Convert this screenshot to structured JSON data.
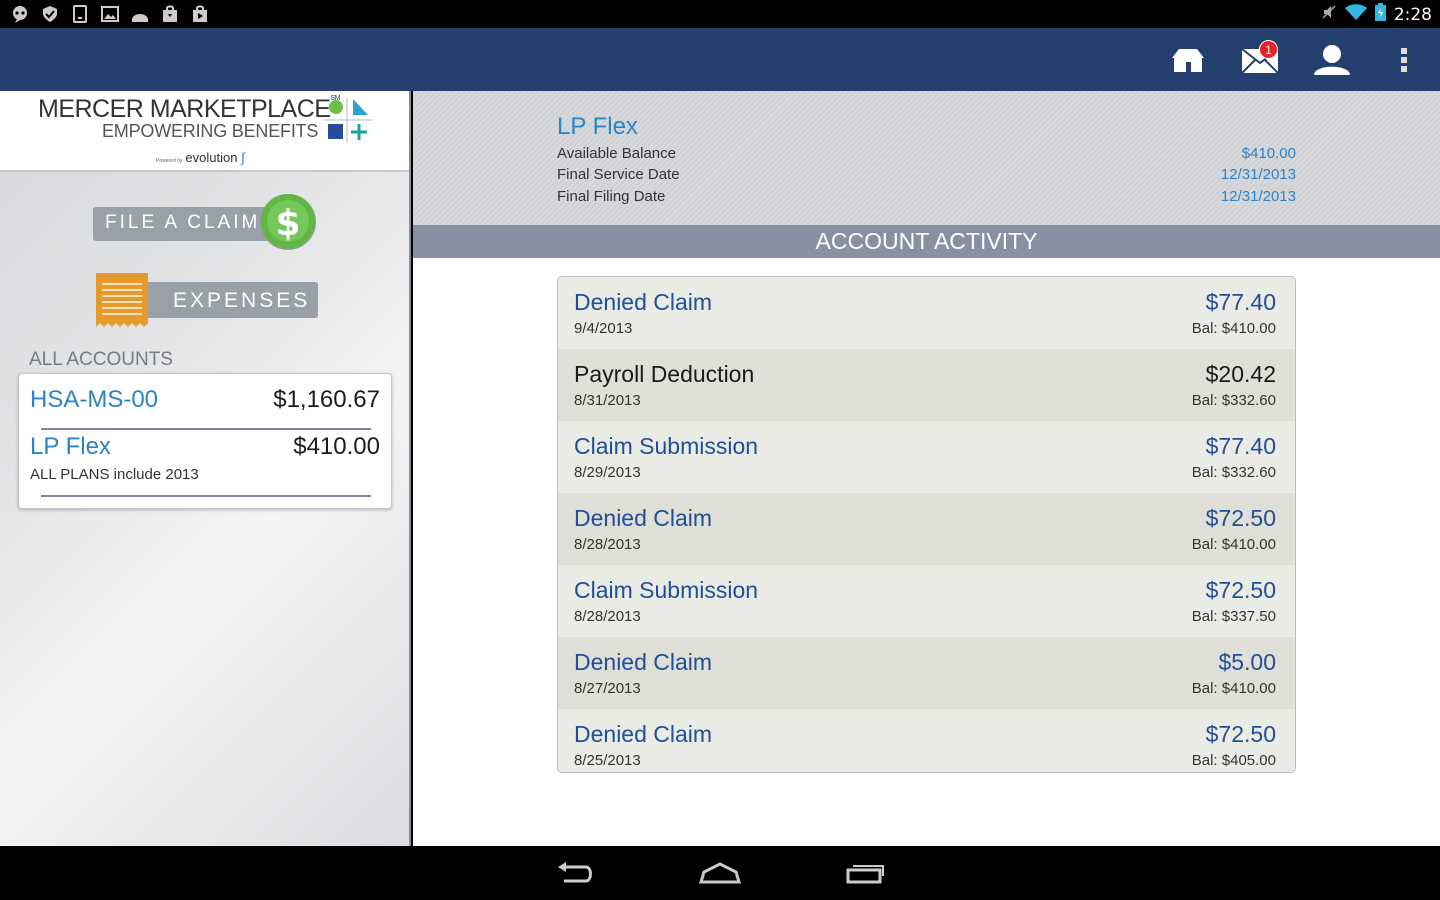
{
  "status_bar": {
    "time": "2:28"
  },
  "action_bar": {
    "mail_badge": "1"
  },
  "logo": {
    "title": "MERCER MARKETPLACE",
    "sm": "SM",
    "subtitle": "EMPOWERING BENEFITS",
    "powered_by": "Powered by",
    "evolution": "evolution"
  },
  "sidebar": {
    "file_claim_label": "FILE A CLAIM",
    "expenses_label": "EXPENSES",
    "all_accounts_label": "ALL ACCOUNTS",
    "accounts": [
      {
        "name": "HSA-MS-00",
        "amount": "$1,160.67",
        "sub": ""
      },
      {
        "name": "LP Flex",
        "amount": "$410.00",
        "sub": "ALL PLANS include 2013"
      }
    ]
  },
  "summary": {
    "title": "LP Flex",
    "rows": [
      {
        "label": "Available Balance",
        "value": "$410.00"
      },
      {
        "label": "Final Service Date",
        "value": "12/31/2013"
      },
      {
        "label": "Final Filing Date",
        "value": "12/31/2013"
      }
    ]
  },
  "activity": {
    "header": "ACCOUNT ACTIVITY",
    "items": [
      {
        "title": "Denied Claim",
        "date": "9/4/2013",
        "amount": "$77.40",
        "balance": "Bal: $410.00"
      },
      {
        "title": "Payroll Deduction",
        "date": "8/31/2013",
        "amount": "$20.42",
        "balance": "Bal: $332.60"
      },
      {
        "title": "Claim Submission",
        "date": "8/29/2013",
        "amount": "$77.40",
        "balance": "Bal: $332.60"
      },
      {
        "title": "Denied Claim",
        "date": "8/28/2013",
        "amount": "$72.50",
        "balance": "Bal: $410.00"
      },
      {
        "title": "Claim Submission",
        "date": "8/28/2013",
        "amount": "$72.50",
        "balance": "Bal: $337.50"
      },
      {
        "title": "Denied Claim",
        "date": "8/27/2013",
        "amount": "$5.00",
        "balance": "Bal: $410.00"
      },
      {
        "title": "Denied Claim",
        "date": "8/25/2013",
        "amount": "$72.50",
        "balance": "Bal: $405.00"
      }
    ]
  },
  "colors": {
    "action_bar": "#24406e",
    "link_blue": "#2a84c6",
    "list_blue": "#1f4f97",
    "activity_bar": "#8890a3"
  }
}
